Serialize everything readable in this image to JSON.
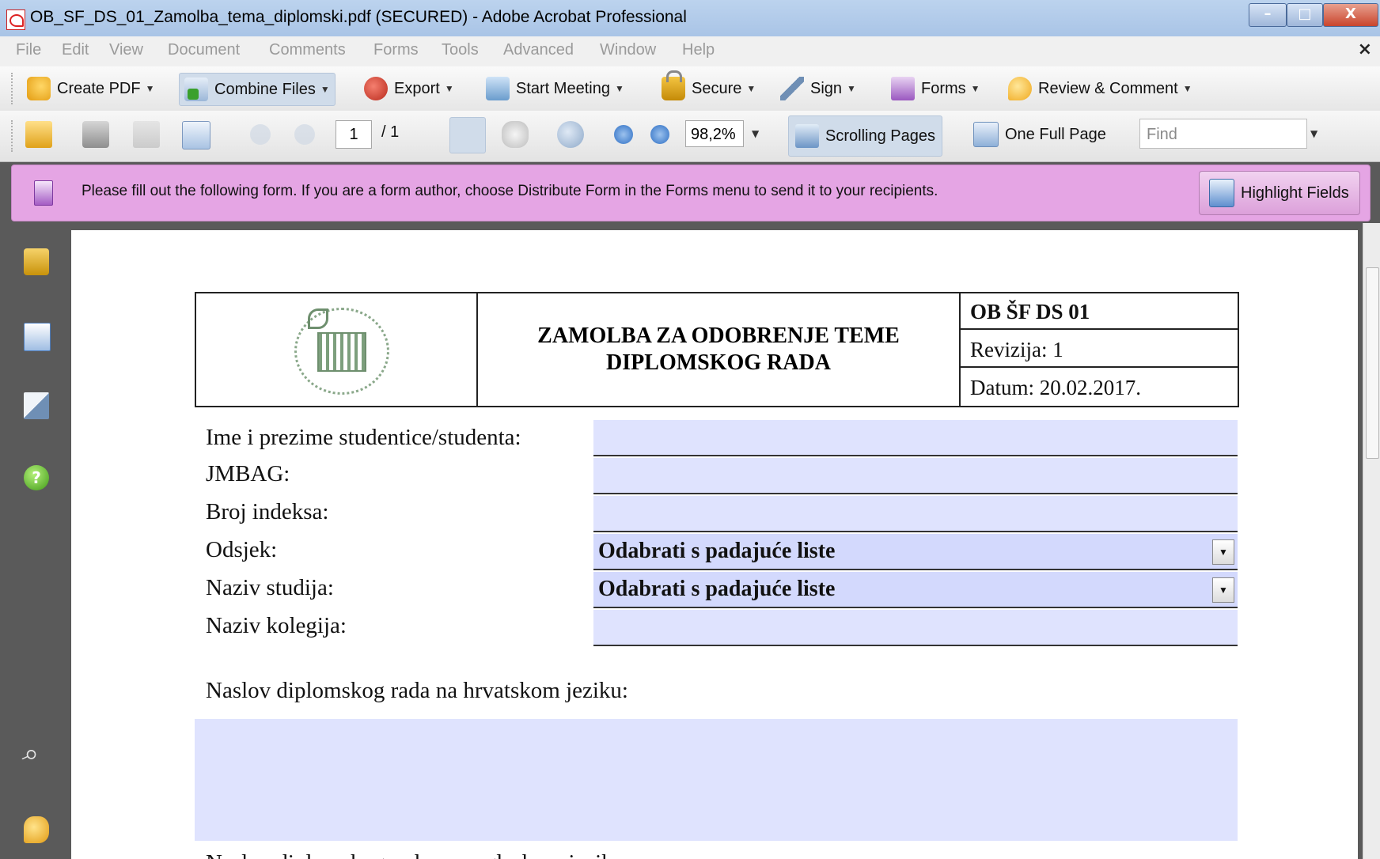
{
  "window": {
    "title": "OB_SF_DS_01_Zamolba_tema_diplomski.pdf (SECURED) - Adobe Acrobat Professional",
    "buttons": [
      "–",
      "□",
      "X"
    ]
  },
  "menu": {
    "items": [
      "File",
      "Edit",
      "View",
      "Document",
      "Comments",
      "Forms",
      "Tools",
      "Advanced",
      "Window",
      "Help"
    ],
    "close": "×"
  },
  "tasks_toolbar": {
    "buttons": [
      {
        "label": "Create PDF",
        "icon": "create-pdf-icon"
      },
      {
        "label": "Combine Files",
        "icon": "combine-files-icon"
      },
      {
        "label": "Export",
        "icon": "export-icon"
      },
      {
        "label": "Start Meeting",
        "icon": "start-meeting-icon"
      },
      {
        "label": "Secure",
        "icon": "lock-icon"
      },
      {
        "label": "Sign",
        "icon": "pen-icon"
      },
      {
        "label": "Forms",
        "icon": "forms-icon"
      },
      {
        "label": "Review & Comment",
        "icon": "review-comment-icon"
      }
    ]
  },
  "nav_toolbar": {
    "page_current": "1",
    "page_total": "/ 1",
    "zoom": "98,2%",
    "scrolling_pages": "Scrolling Pages",
    "one_full_page": "One Full Page",
    "find_placeholder": "Find"
  },
  "form_notice": {
    "text": "Please fill out the following form. If you are a form author, choose Distribute Form in the Forms menu to send it to your recipients.",
    "highlight_button": "Highlight Fields"
  },
  "document": {
    "header": {
      "title_line1": "ZAMOLBA ZA ODOBRENJE TEME",
      "title_line2": "DIPLOMSKOG RADA",
      "code": "OB ŠF DS 01",
      "revision": "Revizija: 1",
      "date": "Datum: 20.02.2017."
    },
    "fields": [
      {
        "label": "Ime i prezime studentice/studenta:",
        "value": ""
      },
      {
        "label": "JMBAG:",
        "value": ""
      },
      {
        "label": "Broj indeksa:",
        "value": ""
      },
      {
        "label": "Odsjek:",
        "value": "Odabrati s padajuće liste"
      },
      {
        "label": "Naziv studija:",
        "value": "Odabrati s padajuće liste"
      },
      {
        "label": "Naziv kolegija:",
        "value": ""
      }
    ],
    "title_hr_label": "Naslov diplomskog rada na hrvatskom jeziku:",
    "title_hr_value": "",
    "next_label_partial": "Naslov diplomskog rada na engleskom jeziku:"
  },
  "colors": {
    "notice_bg": "#e5a5e4",
    "field_bg": "#dfe3fe",
    "select_bg": "#d3d9fd"
  }
}
